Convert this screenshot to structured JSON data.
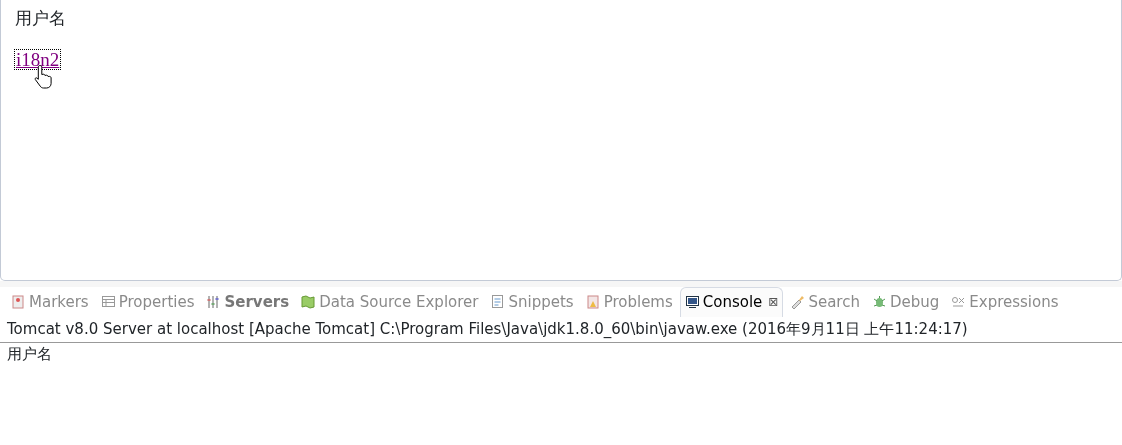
{
  "browser": {
    "heading": "用户名",
    "link": {
      "label": "i18n2",
      "visited": true,
      "focused": true
    }
  },
  "views": {
    "tabs": [
      {
        "label": "Markers",
        "selected": false,
        "bold": false
      },
      {
        "label": "Properties",
        "selected": false,
        "bold": false
      },
      {
        "label": "Servers",
        "selected": false,
        "bold": true
      },
      {
        "label": "Data Source Explorer",
        "selected": false,
        "bold": false
      },
      {
        "label": "Snippets",
        "selected": false,
        "bold": false
      },
      {
        "label": "Problems",
        "selected": false,
        "bold": false
      },
      {
        "label": "Console",
        "selected": true,
        "bold": false,
        "close": "⊠"
      },
      {
        "label": "Search",
        "selected": false,
        "bold": false
      },
      {
        "label": "Debug",
        "selected": false,
        "bold": false
      },
      {
        "label": "Expressions",
        "selected": false,
        "bold": false
      }
    ]
  },
  "console": {
    "header": "Tomcat v8.0 Server at localhost [Apache Tomcat] C:\\Program Files\\Java\\jdk1.8.0_60\\bin\\javaw.exe (2016年9月11日 上午11:24:17)",
    "lines": [
      "用户名"
    ]
  }
}
